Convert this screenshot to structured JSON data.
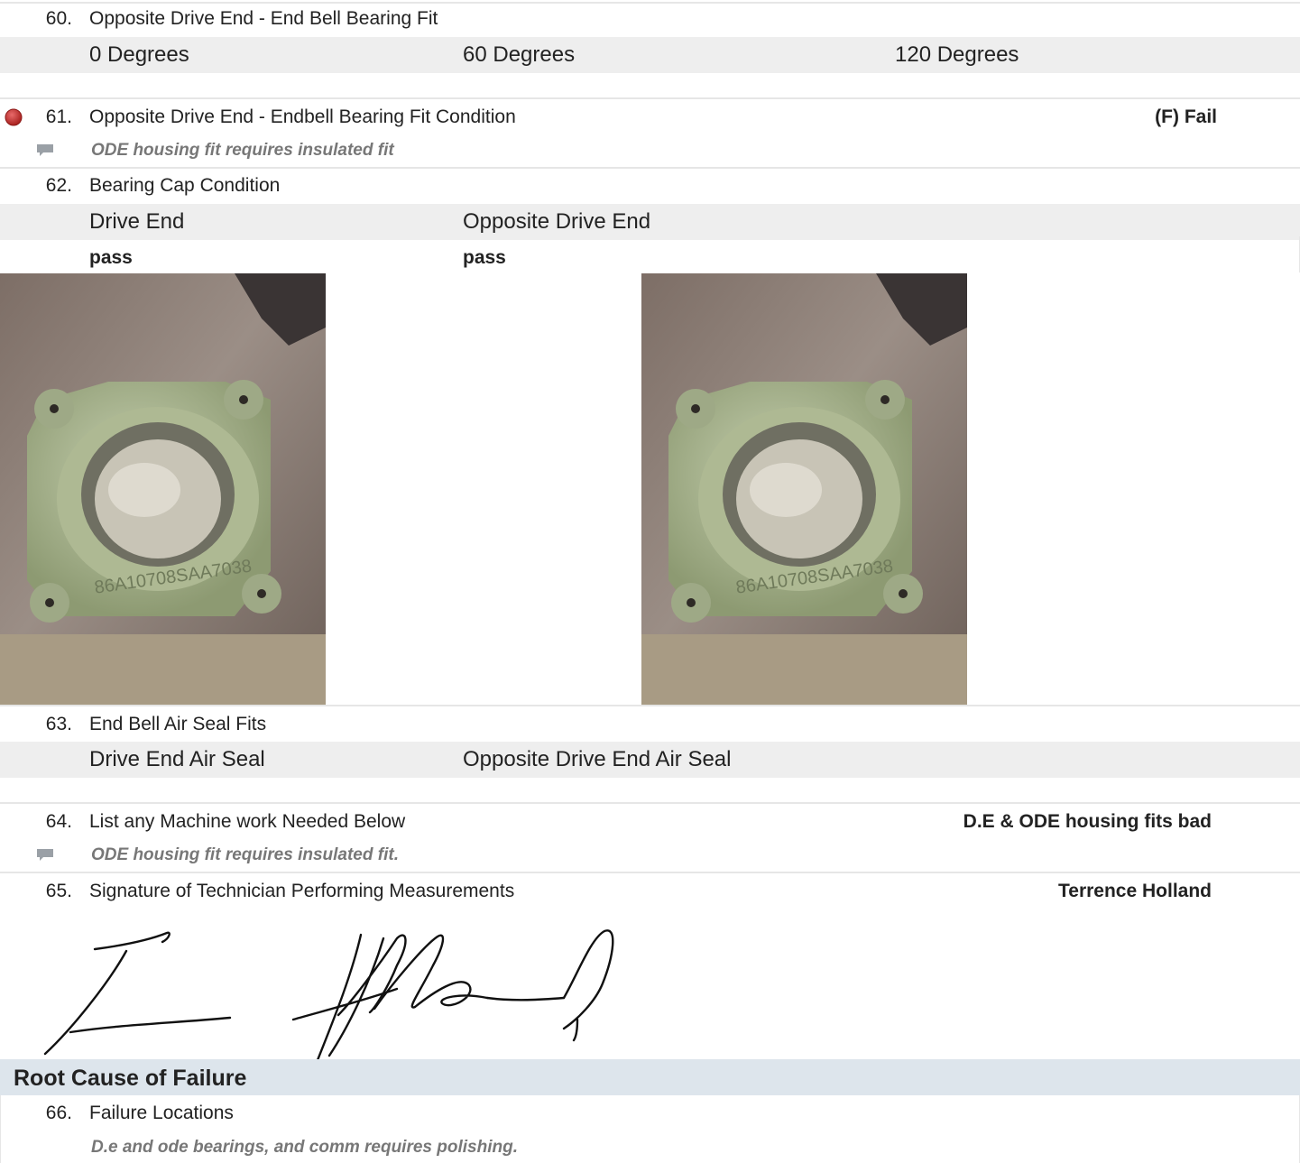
{
  "items": [
    {
      "num": "60.",
      "label": "Opposite Drive End - End Bell Bearing Fit",
      "columns": [
        "0 Degrees",
        "60 Degrees",
        "120 Degrees"
      ]
    },
    {
      "num": "61.",
      "label": "Opposite Drive End - Endbell Bearing Fit Condition",
      "answer": "(F) Fail",
      "comment": "ODE housing fit requires insulated fit",
      "status_color": "#c0392b"
    },
    {
      "num": "62.",
      "label": "Bearing Cap Condition",
      "columns": [
        "Drive End",
        "Opposite Drive End"
      ],
      "values": [
        "pass",
        "pass"
      ],
      "photo_lettering": "86A10708SAA7038"
    },
    {
      "num": "63.",
      "label": "End Bell Air Seal Fits",
      "columns": [
        "Drive End Air Seal",
        "Opposite Drive End Air Seal"
      ]
    },
    {
      "num": "64.",
      "label": "List any Machine work Needed Below",
      "answer": "D.E & ODE housing fits bad",
      "comment": "ODE housing fit requires insulated fit."
    },
    {
      "num": "65.",
      "label": "Signature of Technician Performing Measurements",
      "answer": "Terrence  Holland"
    },
    {
      "num": "66.",
      "label": "Failure Locations",
      "comment": "D.e and ode bearings, and comm requires polishing."
    }
  ],
  "section": {
    "title": "Root Cause of Failure"
  },
  "icons": {
    "status": "status-dot-icon",
    "comment": "comment-icon"
  }
}
